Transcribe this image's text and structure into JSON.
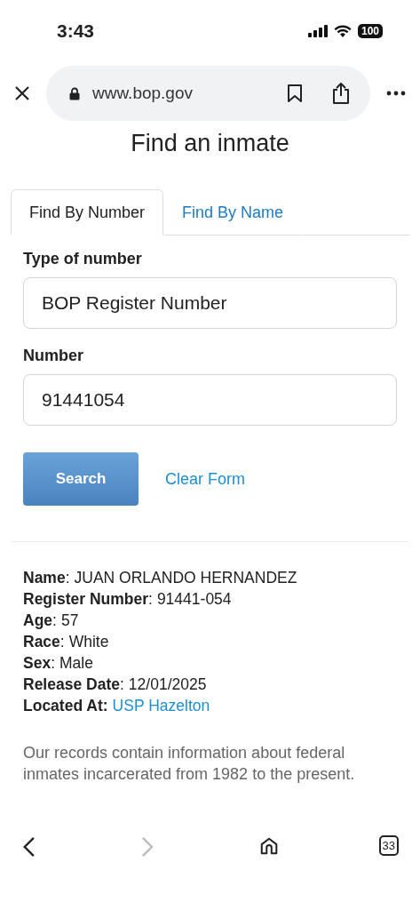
{
  "status_bar": {
    "time": "3:43",
    "battery": "100"
  },
  "browser": {
    "url": "www.bop.gov"
  },
  "page": {
    "title": "Find an inmate",
    "tabs": [
      {
        "label": "Find By Number",
        "selected": true
      },
      {
        "label": "Find By Name",
        "selected": false
      }
    ],
    "fields": [
      {
        "label": "Type of number",
        "value": "BOP Register Number"
      },
      {
        "label": "Number",
        "value": "91441054"
      }
    ],
    "search_button": "Search",
    "clear_link": "Clear Form",
    "record": [
      {
        "label": "**Name**:",
        "value": "JUAN ORLANDO HERNANDEZ",
        "kind": "text"
      },
      {
        "label": "**Register Number**:",
        "value": "91441-054",
        "kind": "text"
      },
      {
        "label": "**Age**:",
        "value": "57",
        "kind": "text"
      },
      {
        "label": "**Race**:",
        "value": "White",
        "kind": "text"
      },
      {
        "label": "**Sex**:",
        "value": "Male",
        "kind": "text"
      },
      {
        "label": "**Release Date**:",
        "value": "12/01/2025",
        "kind": "text"
      },
      {
        "label": "**Located At:**",
        "value": "USP Hazelton",
        "kind": "link"
      }
    ],
    "note": "Our records contain information about federal inmates incarcerated from 1982 to the present."
  },
  "toolbar": {
    "back_disabled": false,
    "forward_disabled": true,
    "tab_count": "33"
  }
}
